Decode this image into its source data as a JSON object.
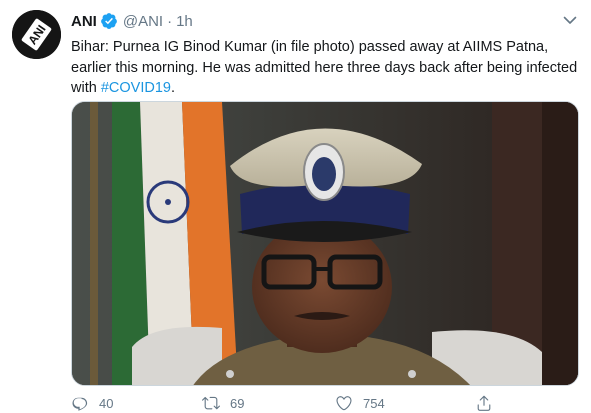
{
  "tweet": {
    "author_name": "ANI",
    "handle": "@ANI",
    "separator": "·",
    "time": "1h",
    "avatar_text": "ANI",
    "text_main": "Bihar: Purnea IG Binod Kumar (in file photo) passed away at AIIMS Patna, earlier this morning. He was admitted here three days back after being infected with ",
    "hashtag": "#COVID19",
    "text_end": ".",
    "media_alt": "Photo of police officer in uniform cap",
    "colors": {
      "text": "#14171a",
      "secondary": "#657786",
      "link": "#1b95e0",
      "verified": "#1da1f2"
    }
  },
  "actions": {
    "reply_count": "40",
    "retweet_count": "69",
    "like_count": "754",
    "icons": [
      "reply-icon",
      "retweet-icon",
      "like-icon",
      "share-icon"
    ]
  }
}
